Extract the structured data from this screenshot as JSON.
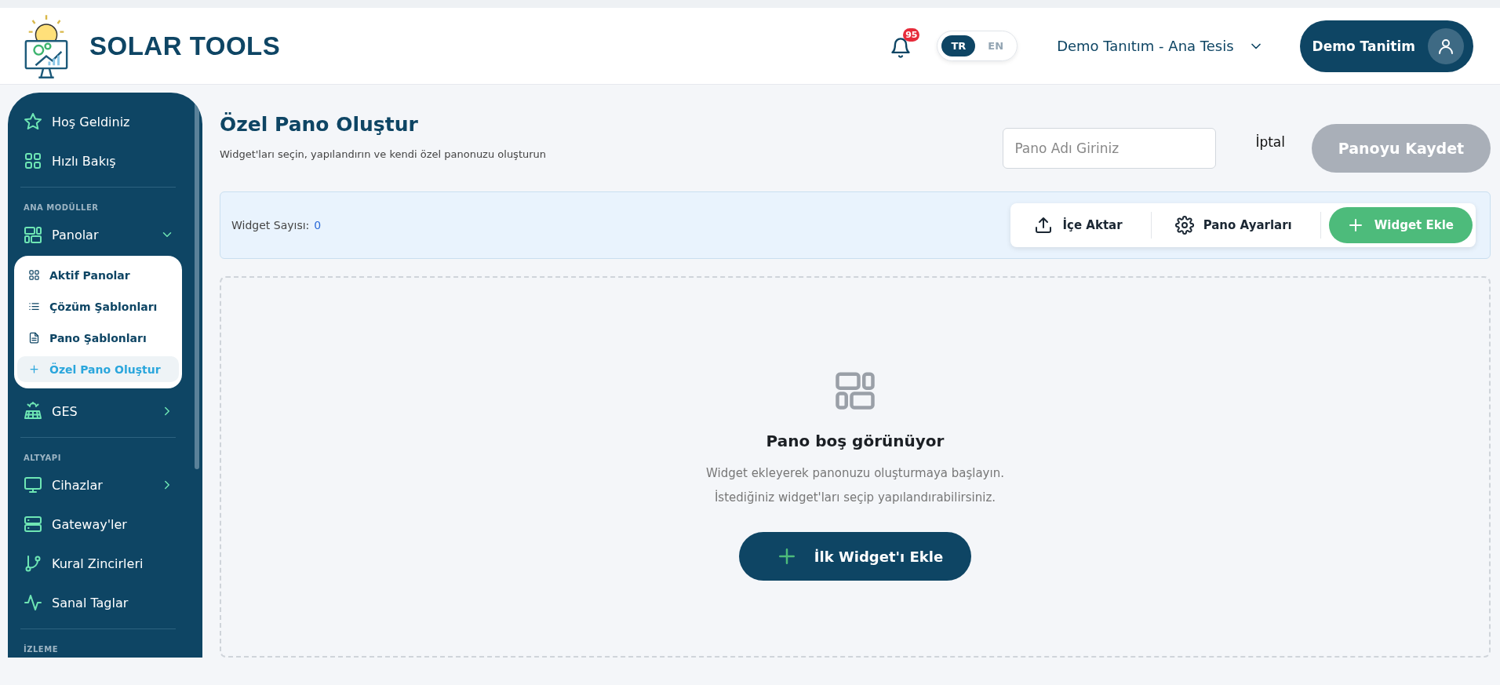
{
  "header": {
    "brand": "SOLAR TOOLS",
    "notifications": {
      "count": "95"
    },
    "languages": [
      {
        "label": "TR",
        "selected": true
      },
      {
        "label": "EN",
        "selected": false
      }
    ],
    "site_selector": {
      "value": "Demo Tanıtım - Ana Tesis"
    },
    "user": {
      "name": "Demo Tanitim"
    }
  },
  "sidebar": {
    "sections": [
      {
        "items": [
          {
            "label": "Hoş Geldiniz"
          },
          {
            "label": "Hızlı Bakış"
          }
        ]
      },
      {
        "title": "ANA MODÜLLER",
        "items": [
          {
            "label": "Panolar",
            "expanded": true,
            "children": [
              {
                "label": "Aktif Panolar",
                "selected": false
              },
              {
                "label": "Çözüm Şablonları",
                "selected": false
              },
              {
                "label": "Pano Şablonları",
                "selected": false
              },
              {
                "label": "Özel Pano Oluştur",
                "selected": true
              }
            ]
          },
          {
            "label": "GES",
            "expanded": false
          }
        ]
      },
      {
        "title": "ALTYAPI",
        "items": [
          {
            "label": "Cihazlar",
            "expanded": false
          },
          {
            "label": "Gateway'ler"
          },
          {
            "label": "Kural Zincirleri"
          },
          {
            "label": "Sanal Taglar"
          }
        ]
      },
      {
        "title": "İZLEME"
      }
    ]
  },
  "page": {
    "title": "Özel Pano Oluştur",
    "subtitle": "Widget'ları seçin, yapılandırın ve kendi özel panonuzu oluşturun",
    "name_field": {
      "placeholder": "Pano Adı Giriniz"
    },
    "cancel": "İptal",
    "save": {
      "label": "Panoyu Kaydet",
      "disabled": true
    }
  },
  "toolbar": {
    "count_label": "Widget Sayısı:",
    "count": "0",
    "actions": [
      {
        "label": "İçe Aktar",
        "kind": "import"
      },
      {
        "label": "Pano Ayarları",
        "kind": "settings"
      },
      {
        "label": "Widget Ekle",
        "kind": "primary"
      }
    ]
  },
  "empty_state": {
    "title": "Pano boş görünüyor",
    "lines": [
      "Widget ekleyerek panonuzu oluşturmaya başlayın.",
      "İstediğiniz widget'ları seçip yapılandırabilirsiniz."
    ],
    "button": "İlk Widget'ı Ekle"
  }
}
